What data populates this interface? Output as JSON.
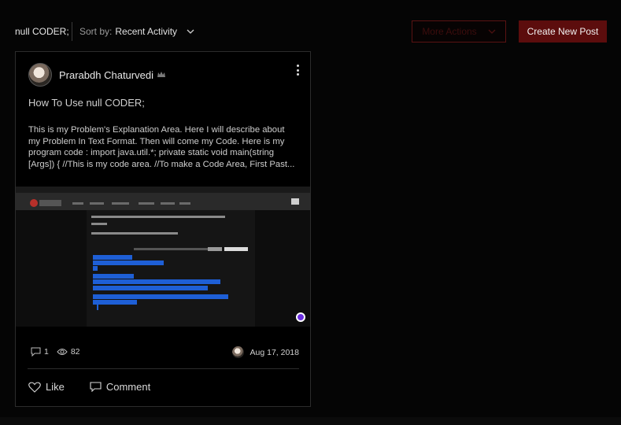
{
  "toolbar": {
    "category": "null CODER;",
    "sort_prefix": "Sort by:",
    "sort_value": "Recent Activity",
    "more_actions": "More Actions",
    "create_post": "Create New Post"
  },
  "post": {
    "author": "Prarabdh Chaturvedi",
    "title": "How To Use null CODER;",
    "excerpt_lines": [
      "This is my Problem's Explanation Area. Here I will describe about",
      "my Problem In Text Format. Then will come my Code. Here is my",
      "program code : import java.util.*; private static void main(string",
      "[Args]) { //This is my code area. //To make a Code Area, First Past..."
    ],
    "comments": "1",
    "views": "82",
    "date": "Aug 17, 2018",
    "like_label": "Like",
    "comment_label": "Comment"
  },
  "icons": {
    "sort": "chevron-down-icon",
    "more_actions": "chevron-down-icon",
    "author_badge": "crown-icon",
    "post_menu": "kebab-icon",
    "comments": "comment-icon",
    "views": "eye-icon",
    "like": "heart-icon",
    "comment_action": "comment-icon"
  },
  "colors": {
    "accent": "#5c0d0d",
    "background": "#050505"
  }
}
